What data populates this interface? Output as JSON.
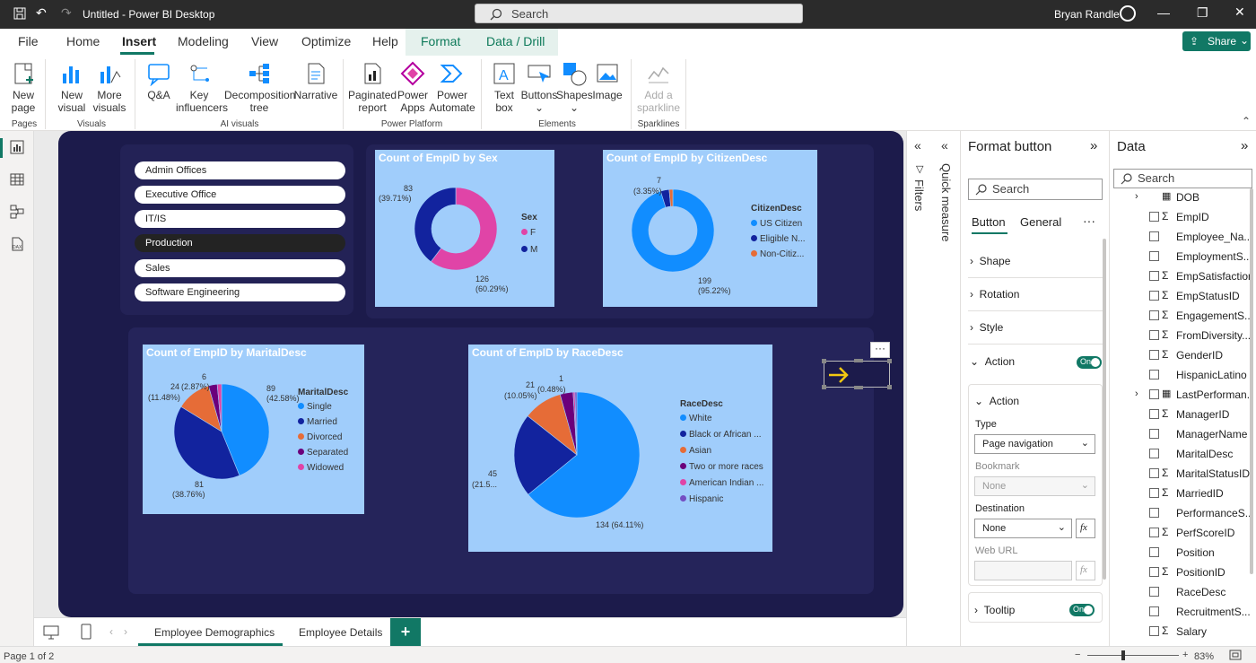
{
  "titlebar": {
    "title": "Untitled - Power BI Desktop",
    "search_placeholder": "Search",
    "user": "Bryan Randle"
  },
  "menu": {
    "items": [
      "File",
      "Home",
      "Insert",
      "Modeling",
      "View",
      "Optimize",
      "Help",
      "Format",
      "Data / Drill"
    ],
    "share": "Share"
  },
  "ribbon": {
    "pages": {
      "new_page": "New\npage",
      "group": "Pages"
    },
    "visuals": {
      "new_visual": "New\nvisual",
      "more_visuals": "More\nvisuals",
      "group": "Visuals"
    },
    "ai": {
      "qa": "Q&A",
      "key_influencers": "Key\ninfluencers",
      "decomp": "Decomposition\ntree",
      "narrative": "Narrative",
      "group": "AI visuals"
    },
    "platform": {
      "paginated": "Paginated\nreport",
      "power_apps": "Power\nApps",
      "power_automate": "Power\nAutomate",
      "group": "Power Platform"
    },
    "elements": {
      "text_box": "Text\nbox",
      "buttons": "Buttons",
      "shapes": "Shapes",
      "image": "Image",
      "group": "Elements"
    },
    "sparklines": {
      "add": "Add a\nsparkline",
      "group": "Sparklines"
    }
  },
  "slicer": {
    "items": [
      "Admin Offices",
      "Executive Office",
      "IT/IS",
      "Production",
      "Sales",
      "Software Engineering"
    ],
    "selected": "Production"
  },
  "charts": {
    "sex": {
      "title": "Count of EmpID by Sex",
      "legend_title": "Sex",
      "legend": [
        "F",
        "M"
      ],
      "label_m": "83",
      "label_m_pct": "(39.71%)",
      "label_f": "126",
      "label_f_pct": "(60.29%)"
    },
    "citizen": {
      "title": "Count of EmpID by CitizenDesc",
      "legend_title": "CitizenDesc",
      "legend": [
        "US Citizen",
        "Eligible N...",
        "Non-Citiz..."
      ],
      "label_small": "7",
      "label_small_pct": "(3.35%)",
      "label_big": "199",
      "label_big_pct": "(95.22%)"
    },
    "marital": {
      "title": "Count of EmpID by MaritalDesc",
      "legend_title": "MaritalDesc",
      "legend": [
        "Single",
        "Married",
        "Divorced",
        "Separated",
        "Widowed"
      ],
      "l_single": "89",
      "l_single_pct": "(42.58%)",
      "l_married": "81",
      "l_married_pct": "(38.76%)",
      "l_divorced": "24",
      "l_divorced_pct": "(11.48%)",
      "l_separated": "(2.87%)",
      "l_widowed": "6"
    },
    "race": {
      "title": "Count of EmpID by RaceDesc",
      "legend_title": "RaceDesc",
      "legend": [
        "White",
        "Black or African ...",
        "Asian",
        "Two or more races",
        "American Indian ...",
        "Hispanic"
      ],
      "l_white": "134 (64.11%)",
      "l_black": "45",
      "l_black_pct": "(21.5...",
      "l_asian": "21",
      "l_asian_pct": "(10.05%)",
      "l_hisp": "1",
      "l_hisp_pct": "(0.48%)"
    }
  },
  "chart_data": [
    {
      "type": "pie",
      "title": "Count of EmpID by Sex",
      "categories": [
        "F",
        "M"
      ],
      "values": [
        126,
        83
      ],
      "donut": true
    },
    {
      "type": "pie",
      "title": "Count of EmpID by CitizenDesc",
      "categories": [
        "US Citizen",
        "Eligible N...",
        "Non-Citiz..."
      ],
      "values": [
        199,
        7,
        3
      ],
      "donut": true
    },
    {
      "type": "pie",
      "title": "Count of EmpID by MaritalDesc",
      "categories": [
        "Single",
        "Married",
        "Divorced",
        "Separated",
        "Widowed"
      ],
      "values": [
        89,
        81,
        24,
        6,
        3
      ]
    },
    {
      "type": "pie",
      "title": "Count of EmpID by RaceDesc",
      "categories": [
        "White",
        "Black or African ...",
        "Asian",
        "Two or more races",
        "American Indian ...",
        "Hispanic"
      ],
      "values": [
        134,
        45,
        21,
        7,
        1,
        1
      ]
    }
  ],
  "colors": {
    "dark_blue": "#12239e",
    "light_blue": "#118dff",
    "pink": "#e044a7",
    "orange": "#e66c37",
    "purple": "#6b007b",
    "violet": "#744ec2",
    "green": "#117865"
  },
  "filters": {
    "quick_measure": "Quick measure",
    "filters": "Filters"
  },
  "format": {
    "title": "Format button",
    "search_placeholder": "Search",
    "tabs": [
      "Button",
      "General"
    ],
    "sections": [
      "Shape",
      "Rotation",
      "Style",
      "Action"
    ],
    "action_toggle": "On",
    "action_sub": "Action",
    "type_label": "Type",
    "type_value": "Page navigation",
    "bookmark_label": "Bookmark",
    "bookmark_value": "None",
    "dest_label": "Destination",
    "dest_value": "None",
    "weburl_label": "Web URL",
    "tooltip": "Tooltip",
    "tooltip_toggle": "On"
  },
  "data": {
    "title": "Data",
    "search_placeholder": "Search",
    "fields": [
      "DOB",
      "EmpID",
      "Employee_Na...",
      "EmploymentS...",
      "EmpSatisfaction",
      "EmpStatusID",
      "EngagementS...",
      "FromDiversity...",
      "GenderID",
      "HispanicLatino",
      "LastPerforman...",
      "ManagerID",
      "ManagerName",
      "MaritalDesc",
      "MaritalStatusID",
      "MarriedID",
      "PerformanceS...",
      "PerfScoreID",
      "Position",
      "PositionID",
      "RaceDesc",
      "RecruitmentS...",
      "Salary"
    ]
  },
  "pages": {
    "tabs": [
      "Employee Demographics",
      "Employee Details"
    ],
    "add": "+"
  },
  "status": {
    "page": "Page 1 of 2",
    "zoom": "83%"
  }
}
